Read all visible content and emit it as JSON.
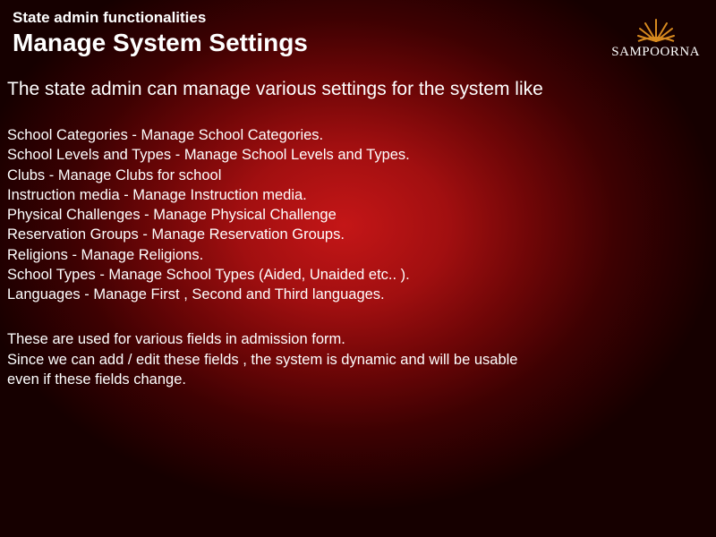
{
  "header": {
    "subtitle": "State admin functionalities",
    "title": "Manage System Settings"
  },
  "brand": "SAMPOORNA",
  "intro": "The state admin can manage various settings for the system like",
  "items": [
    "School Categories - Manage School Categories.",
    "School Levels and Types - Manage School Levels and Types.",
    "Clubs - Manage Clubs for school",
    "Instruction media - Manage Instruction media.",
    "Physical Challenges - Manage Physical Challenge",
    "Reservation Groups - Manage Reservation Groups.",
    "Religions - Manage Religions.",
    "School Types - Manage School Types (Aided, Unaided etc.. ).",
    "Languages -  Manage First , Second and Third languages."
  ],
  "footer": {
    "line1": "These are used for various fields in admission form.",
    "line2": "Since we can add / edit these fields , the system is dynamic and will be usable",
    "line3": "even if these fields change."
  }
}
